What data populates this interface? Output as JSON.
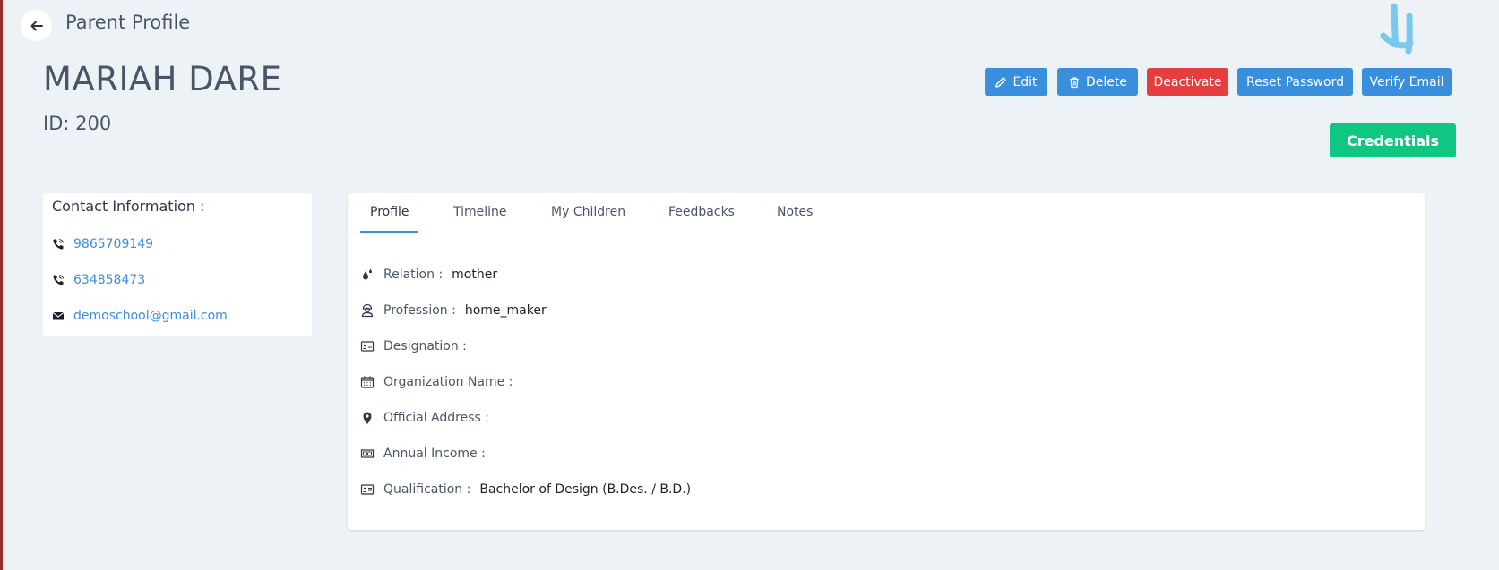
{
  "header": {
    "title": "Parent Profile",
    "name": "MARIAH DARE",
    "id_label": "ID:",
    "id_value": "200"
  },
  "actions": {
    "edit": "Edit",
    "delete": "Delete",
    "deactivate": "Deactivate",
    "reset_password": "Reset Password",
    "verify_email": "Verify Email",
    "credentials": "Credentials"
  },
  "contact": {
    "title": "Contact Information :",
    "phones": [
      "9865709149",
      "634858473"
    ],
    "email": "demoschool@gmail.com"
  },
  "tabs": [
    {
      "label": "Profile",
      "active": true
    },
    {
      "label": "Timeline",
      "active": false
    },
    {
      "label": "My Children",
      "active": false
    },
    {
      "label": "Feedbacks",
      "active": false
    },
    {
      "label": "Notes",
      "active": false
    }
  ],
  "profile_fields": [
    {
      "label": "Relation :",
      "value": "mother",
      "icon": "drops-icon"
    },
    {
      "label": "Profession :",
      "value": "home_maker",
      "icon": "worker-icon"
    },
    {
      "label": "Designation :",
      "value": "",
      "icon": "id-card-icon"
    },
    {
      "label": "Organization Name :",
      "value": "",
      "icon": "calendar-icon"
    },
    {
      "label": "Official Address :",
      "value": "",
      "icon": "map-pin-icon"
    },
    {
      "label": "Annual Income :",
      "value": "",
      "icon": "money-icon"
    },
    {
      "label": "Qualification :",
      "value": "Bachelor of Design (B.Des. / B.D.)",
      "icon": "id-card-icon"
    }
  ],
  "colors": {
    "background": "#edf2f7",
    "primary": "#3a8fdc",
    "danger": "#e53e3e",
    "success": "#0fc683",
    "text": "#4a5568"
  }
}
